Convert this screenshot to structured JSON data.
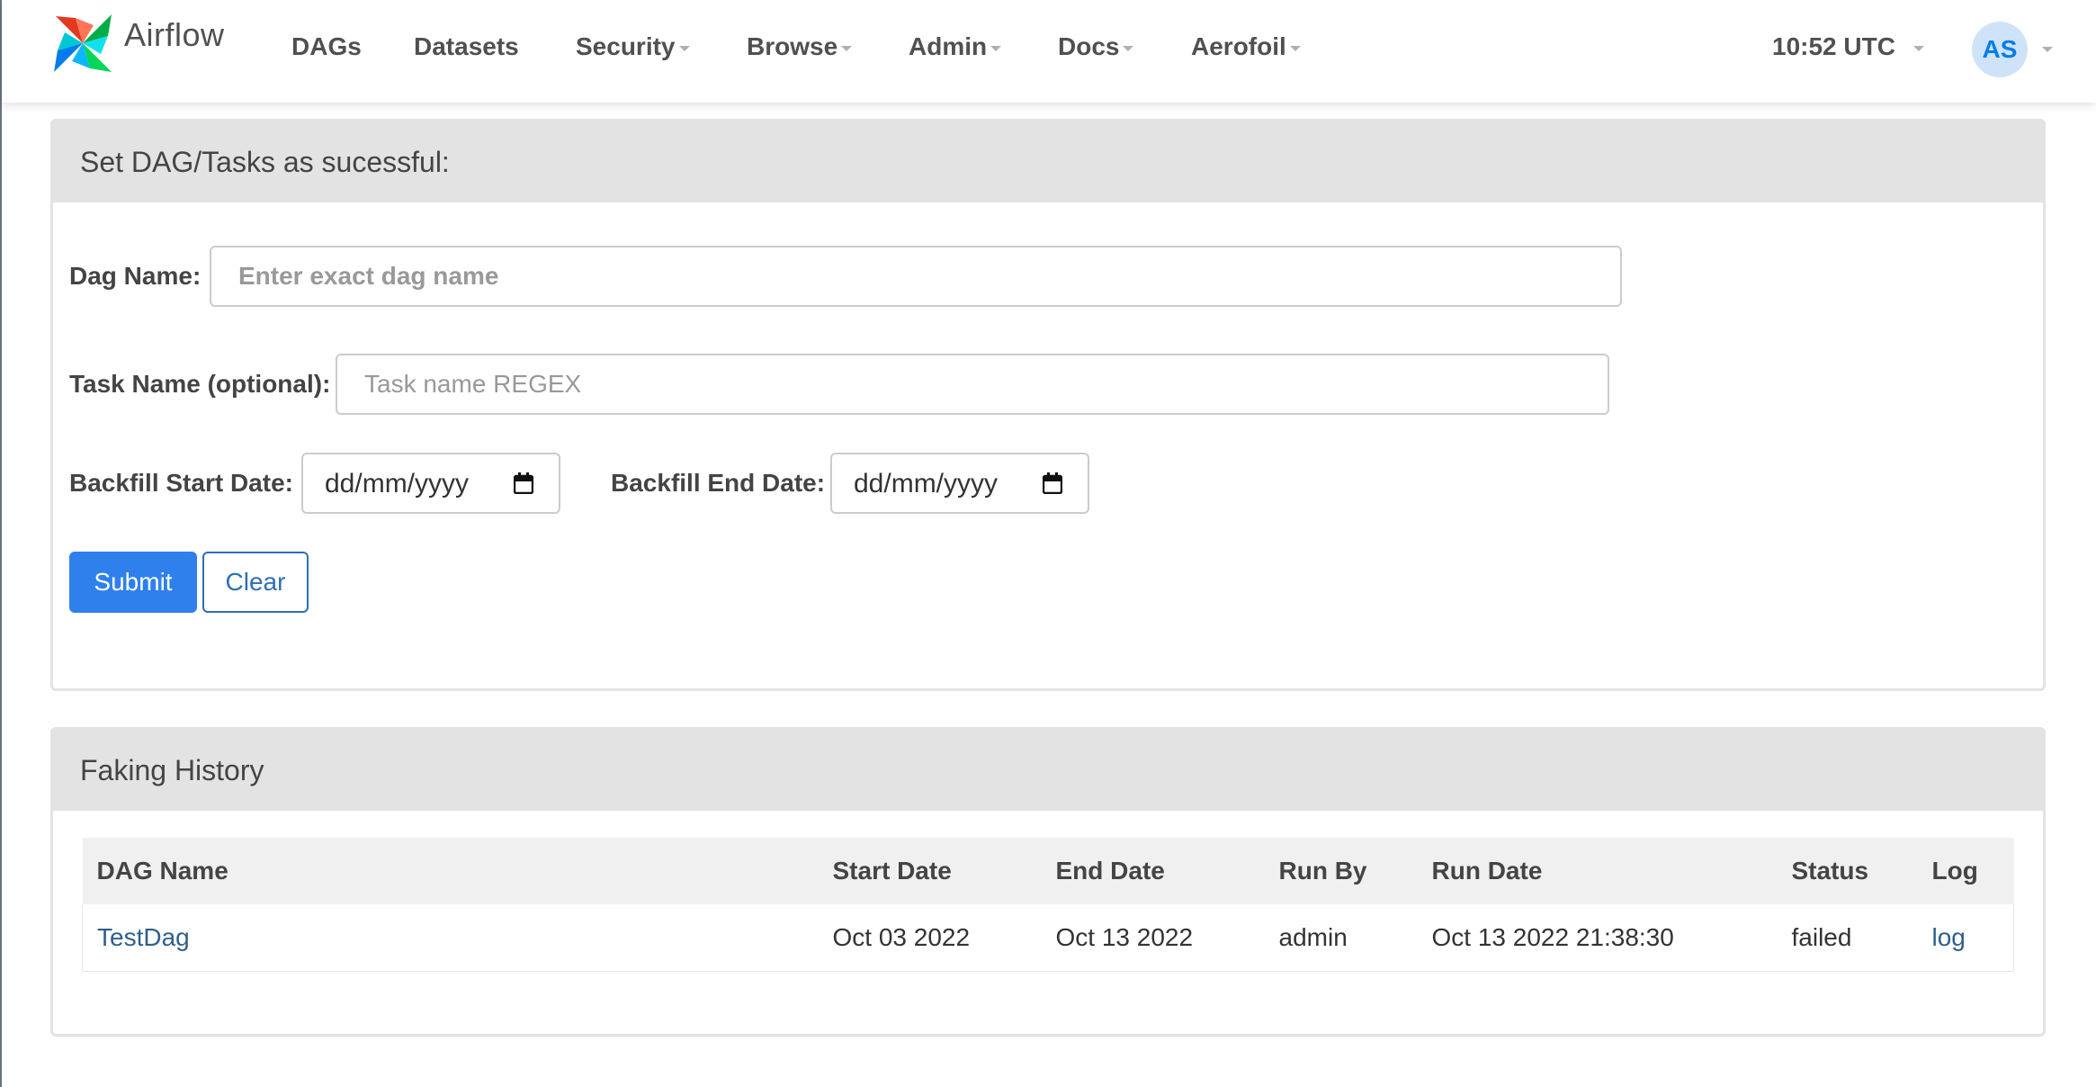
{
  "navbar": {
    "brand": "Airflow",
    "items": [
      {
        "label": "DAGs",
        "dropdown": false
      },
      {
        "label": "Datasets",
        "dropdown": false
      },
      {
        "label": "Security",
        "dropdown": true
      },
      {
        "label": "Browse",
        "dropdown": true
      },
      {
        "label": "Admin",
        "dropdown": true
      },
      {
        "label": "Docs",
        "dropdown": true
      },
      {
        "label": "Aerofoil",
        "dropdown": true
      }
    ],
    "time": "10:52 UTC",
    "user_initials": "AS"
  },
  "form_panel": {
    "title": "Set DAG/Tasks as sucessful:",
    "dag_name_label": "Dag Name:",
    "dag_name_placeholder": "Enter exact dag name",
    "dag_name_value": "",
    "task_name_label": "Task Name (optional):",
    "task_name_placeholder": "Task name REGEX",
    "task_name_value": "",
    "start_date_label": "Backfill Start Date:",
    "start_date_value": "dd/mm/yyyy",
    "end_date_label": "Backfill End Date:",
    "end_date_value": "dd/mm/yyyy",
    "submit_label": "Submit",
    "clear_label": "Clear"
  },
  "history_panel": {
    "title": "Faking History",
    "columns": [
      "DAG Name",
      "Start Date",
      "End Date",
      "Run By",
      "Run Date",
      "Status",
      "Log"
    ],
    "rows": [
      {
        "dag_name": "TestDag",
        "start_date": "Oct 03 2022",
        "end_date": "Oct 13 2022",
        "run_by": "admin",
        "run_date": "Oct 13 2022 21:38:30",
        "status": "failed",
        "log": "log"
      }
    ]
  },
  "colors": {
    "primary": "#2f80ed",
    "link": "#2f5f8a",
    "panel_heading": "#e3e3e3",
    "avatar_bg": "#cfe3f8",
    "avatar_text": "#017cee"
  }
}
